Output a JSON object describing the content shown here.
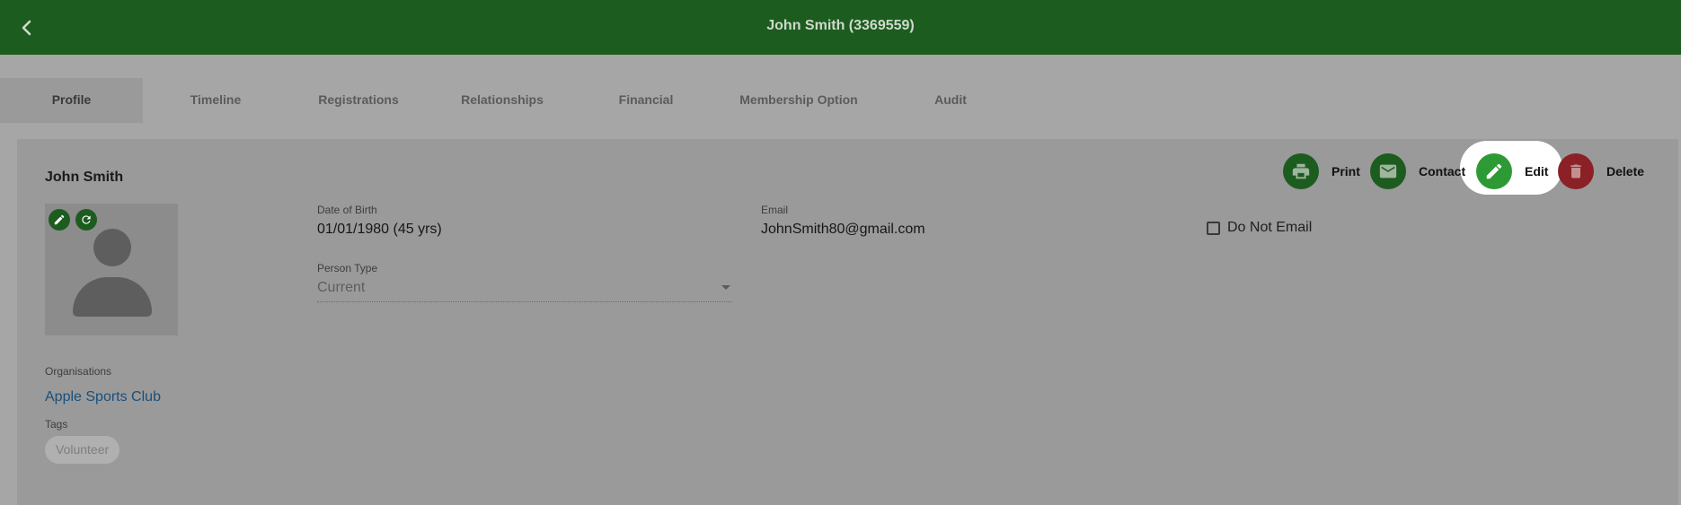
{
  "header": {
    "title": "John Smith (3369559)",
    "back_icon": "chevron-left-icon"
  },
  "tabs": [
    {
      "label": "Profile",
      "active": true
    },
    {
      "label": "Timeline"
    },
    {
      "label": "Registrations"
    },
    {
      "label": "Relationships"
    },
    {
      "label": "Financial"
    },
    {
      "label": "Membership Option"
    },
    {
      "label": "Audit"
    }
  ],
  "profile": {
    "name": "John Smith",
    "avatar_actions": [
      "pencil-icon",
      "refresh-icon"
    ],
    "dob": {
      "label": "Date of Birth",
      "value": "01/01/1980 (45 yrs)"
    },
    "person_type": {
      "label": "Person Type",
      "value": "Current"
    },
    "email": {
      "label": "Email",
      "value": "JohnSmith80@gmail.com"
    },
    "do_not_email": {
      "label": "Do Not Email",
      "checked": false
    },
    "organisations": {
      "label": "Organisations",
      "items": [
        "Apple Sports Club"
      ]
    },
    "tags": {
      "label": "Tags",
      "items": [
        "Volunteer"
      ]
    }
  },
  "actions": [
    {
      "label": "Print",
      "icon": "printer-icon",
      "color": "#1d5c1f"
    },
    {
      "label": "Contact",
      "icon": "mail-icon",
      "color": "#1d5c1f"
    },
    {
      "label": "Edit",
      "icon": "pencil-icon",
      "color": "#2e9a35",
      "highlighted": true
    },
    {
      "label": "Delete",
      "icon": "trash-icon",
      "color": "#8b2126"
    }
  ],
  "colors": {
    "header_bg": "#1d5c1f",
    "link": "#1b4f7a",
    "delete": "#8b2126"
  }
}
